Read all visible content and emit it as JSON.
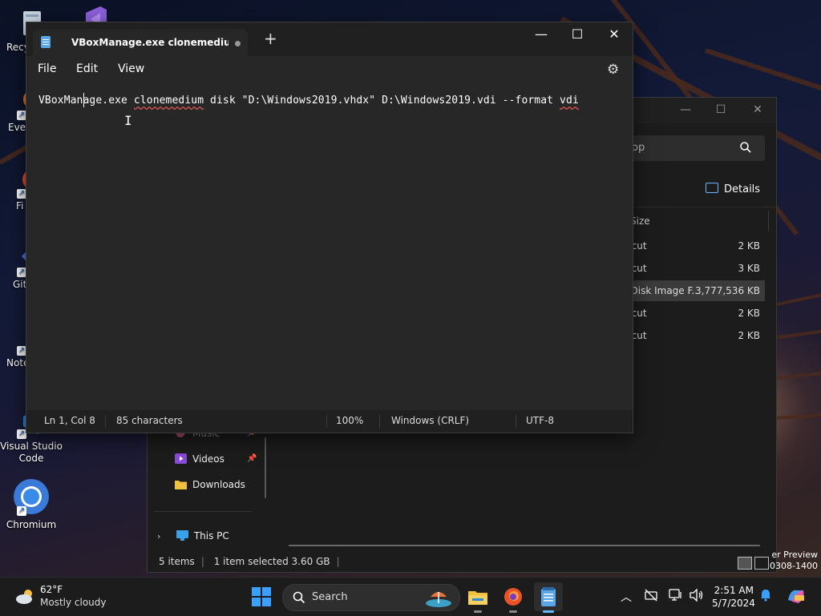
{
  "desktop": {
    "icons": [
      {
        "label": "Recy"
      },
      {
        "label": "Ever"
      },
      {
        "label": "Fi"
      },
      {
        "label": "Git"
      },
      {
        "label": "Note"
      },
      {
        "label": "Visual Studio Code"
      },
      {
        "label": "Chromium"
      }
    ],
    "build_line1": "er Preview",
    "build_line2": "0308-1400"
  },
  "notepad": {
    "tab_title": "VBoxManage.exe clonemedium dis",
    "new_tab": "+",
    "controls": {
      "minimize": "—",
      "maximize": "☐",
      "close": "✕"
    },
    "menus": [
      "File",
      "Edit",
      "View"
    ],
    "settings_icon": "gear-icon",
    "text": {
      "part1": "VBoxMan",
      "part2": "age.exe ",
      "word_misspelled1": "clonemedium",
      "part3": " disk \"D:\\Windows2019.vhdx\" D:\\Windows2019.vdi --format ",
      "word_misspelled2": "vdi"
    },
    "status": {
      "position": "Ln 1, Col 8",
      "characters": "85 characters",
      "zoom": "100%",
      "line_ending": "Windows (CRLF)",
      "encoding": "UTF-8"
    }
  },
  "explorer": {
    "controls": {
      "minimize": "—",
      "maximize": "☐",
      "close": "✕"
    },
    "search_text": "op",
    "details_label": "Details",
    "size_header": "Size",
    "files": [
      {
        "type": "rtcut",
        "size": "2 KB"
      },
      {
        "type": "rtcut",
        "size": "3 KB"
      },
      {
        "type": ") Disk Image F...",
        "size": "3,777,536 KB"
      },
      {
        "type": "rtcut",
        "size": "2 KB"
      },
      {
        "type": "rtcut",
        "size": "2 KB"
      }
    ],
    "nav": {
      "music": "Music",
      "videos": "Videos",
      "downloads": "Downloads",
      "this_pc": "This PC"
    },
    "status": {
      "items": "5 items",
      "selected": "1 item selected  3.60 GB"
    }
  },
  "taskbar": {
    "weather_temp": "62°F",
    "weather_desc": "Mostly cloudy",
    "search_label": "Search",
    "time": "2:51 AM",
    "date": "5/7/2024"
  },
  "colors": {
    "accent": "#3aa0ff",
    "notepad_bg": "#272727",
    "titlebar": "#202020",
    "spell_error": "#e05555"
  }
}
